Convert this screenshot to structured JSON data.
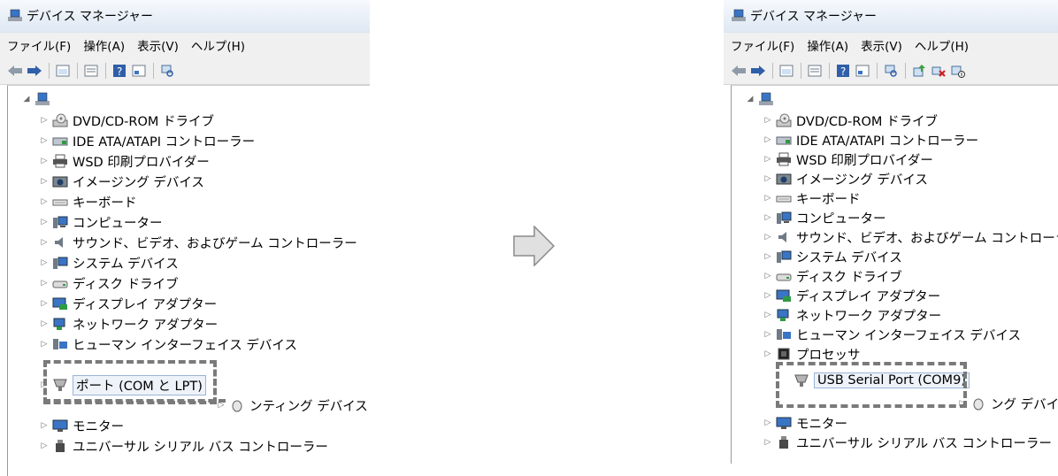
{
  "window_title": "デバイス マネージャー",
  "menu": [
    "ファイル(F)",
    "操作(A)",
    "表示(V)",
    "ヘルプ(H)"
  ],
  "left_tree": [
    {
      "label": "DVD/CD-ROM ドライブ",
      "icon": "dvd-drive-icon"
    },
    {
      "label": "IDE ATA/ATAPI コントローラー",
      "icon": "ide-controller-icon"
    },
    {
      "label": "WSD 印刷プロバイダー",
      "icon": "printer-icon"
    },
    {
      "label": "イメージング デバイス",
      "icon": "camera-icon"
    },
    {
      "label": "キーボード",
      "icon": "keyboard-icon"
    },
    {
      "label": "コンピューター",
      "icon": "computer-icon"
    },
    {
      "label": "サウンド、ビデオ、およびゲーム コントローラー",
      "icon": "speaker-icon"
    },
    {
      "label": "システム デバイス",
      "icon": "system-device-icon"
    },
    {
      "label": "ディスク ドライブ",
      "icon": "disk-drive-icon"
    },
    {
      "label": "ディスプレイ アダプター",
      "icon": "display-adapter-icon"
    },
    {
      "label": "ネットワーク アダプター",
      "icon": "network-adapter-icon"
    },
    {
      "label": "ヒューマン インターフェイス デバイス",
      "icon": "hid-icon"
    },
    {
      "label": "ポート (COM と LPT)",
      "icon": "port-icon"
    },
    {
      "label": "ンティング デバイス",
      "icon": "pointing-device-icon"
    },
    {
      "label": "モニター",
      "icon": "monitor-icon"
    },
    {
      "label": "ユニバーサル シリアル バス コントローラー",
      "icon": "usb-icon"
    }
  ],
  "right_tree": [
    {
      "label": "DVD/CD-ROM ドライブ",
      "icon": "dvd-drive-icon"
    },
    {
      "label": "IDE ATA/ATAPI コントローラー",
      "icon": "ide-controller-icon"
    },
    {
      "label": "WSD 印刷プロバイダー",
      "icon": "printer-icon"
    },
    {
      "label": "イメージング デバイス",
      "icon": "camera-icon"
    },
    {
      "label": "キーボード",
      "icon": "keyboard-icon"
    },
    {
      "label": "コンピューター",
      "icon": "computer-icon"
    },
    {
      "label": "サウンド、ビデオ、およびゲーム コントローラー",
      "icon": "speaker-icon"
    },
    {
      "label": "システム デバイス",
      "icon": "system-device-icon"
    },
    {
      "label": "ディスク ドライブ",
      "icon": "disk-drive-icon"
    },
    {
      "label": "ディスプレイ アダプター",
      "icon": "display-adapter-icon"
    },
    {
      "label": "ネットワーク アダプター",
      "icon": "network-adapter-icon"
    },
    {
      "label": "ヒューマン インターフェイス デバイス",
      "icon": "hid-icon"
    },
    {
      "label": "プロセッサ",
      "icon": "processor-icon"
    },
    {
      "label": "USB Serial Port (COM9)",
      "icon": "port-icon"
    },
    {
      "label": "ング デバイス",
      "icon": "pointing-device-icon"
    },
    {
      "label": "モニター",
      "icon": "monitor-icon"
    },
    {
      "label": "ユニバーサル シリアル バス コントローラー",
      "icon": "usb-icon"
    }
  ],
  "colors": {
    "accent_blue": "#2f5fa8",
    "dash": "#7a7a7a",
    "arrow_fill": "#e0e0e0",
    "arrow_stroke": "#8a8a8a"
  }
}
